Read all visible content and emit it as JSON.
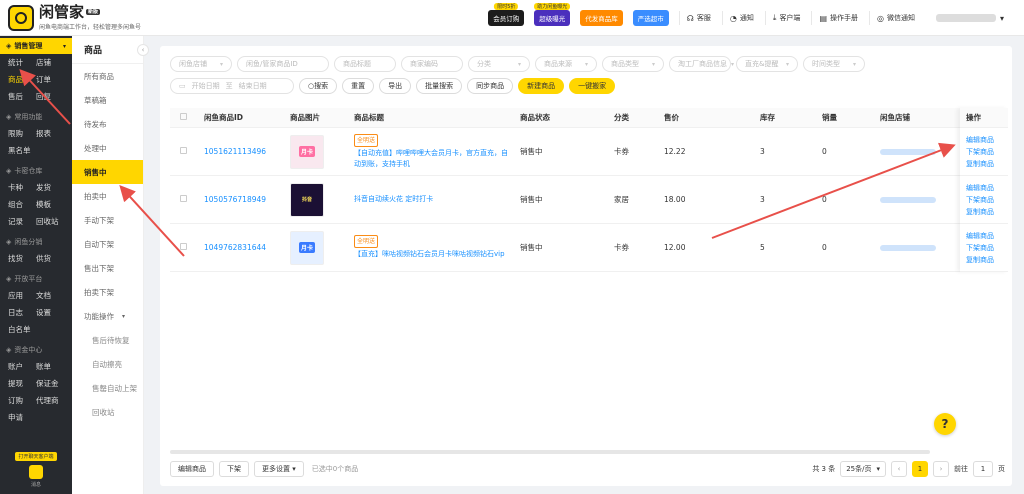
{
  "brand": {
    "name": "闲管家",
    "badge": "新版",
    "slogan": "闲鱼电商端工作台，轻松管理多闲鱼号"
  },
  "header": {
    "promos": [
      {
        "tag": "限时5折",
        "label": "会员订购",
        "bg": "#1c1c1c"
      },
      {
        "tag": "助力闲鱼曝光",
        "label": "超级曝光",
        "bg": "#4b2fbd"
      },
      {
        "tag": "",
        "label": "代发商品库",
        "bg": "#ff8a00"
      },
      {
        "tag": "",
        "label": "严选超市",
        "bg": "#3a8dff"
      }
    ],
    "links": [
      {
        "icon": "headset-icon",
        "glyph": "☊",
        "label": "客服"
      },
      {
        "icon": "bell-icon",
        "glyph": "◔",
        "label": "通知"
      },
      {
        "icon": "download-icon",
        "glyph": "⤓",
        "label": "客户端"
      },
      {
        "icon": "book-icon",
        "glyph": "▤",
        "label": "操作手册"
      },
      {
        "icon": "wechat-icon",
        "glyph": "◎",
        "label": "微信通知"
      }
    ]
  },
  "nav1": {
    "groups": [
      {
        "icon": "tag-icon",
        "title": "销售管理",
        "active": true,
        "items": [
          "统计",
          "店铺",
          "商品",
          "订单",
          "售后",
          "回复"
        ],
        "selected": "商品"
      },
      {
        "icon": "grid-icon",
        "title": "常用功能",
        "items": [
          "限购",
          "报表",
          "黑名单"
        ]
      },
      {
        "icon": "card-icon",
        "title": "卡密仓库",
        "items": [
          "卡种",
          "发货",
          "组合",
          "模板",
          "记录",
          "回收站"
        ]
      },
      {
        "icon": "share-icon",
        "title": "闲鱼分销",
        "items": [
          "找货",
          "供货"
        ]
      },
      {
        "icon": "api-icon",
        "title": "开放平台",
        "items": [
          "应用",
          "文档",
          "日志",
          "设置",
          "白名单"
        ]
      },
      {
        "icon": "wallet-icon",
        "title": "资金中心",
        "items": [
          "账户",
          "账单",
          "提现",
          "保证金",
          "订购",
          "代理商",
          "申请"
        ]
      }
    ],
    "bottom": {
      "tag": "打开聊天客户端",
      "label": "消息"
    }
  },
  "nav2": {
    "title": "商品",
    "items": [
      "所有商品",
      "草稿箱",
      "待发布",
      "处理中",
      "销售中",
      "拍卖中",
      "手动下架",
      "自动下架",
      "售出下架",
      "拍卖下架"
    ],
    "active": "销售中",
    "group": "功能操作",
    "subs": [
      "售后待恢复",
      "自动擦亮",
      "售罄自动上架",
      "回收站"
    ]
  },
  "filters": {
    "row1": [
      "闲鱼店铺",
      "闲鱼/管家商品ID",
      "商品标题",
      "商家编码",
      "分类",
      "商品来源",
      "商品类型",
      "淘工厂商品信息",
      "直充&提醒",
      "时间类型"
    ],
    "date_start": "开始日期",
    "date_sep": "至",
    "date_end": "结束日期",
    "buttons": [
      "搜索",
      "重置",
      "导出",
      "批量搜索",
      "同步商品"
    ],
    "yellow_buttons": [
      "新建商品",
      "一键搬家"
    ]
  },
  "table": {
    "headers": [
      "闲鱼商品ID",
      "商品图片",
      "商品标题",
      "商品状态",
      "分类",
      "售价",
      "库存",
      "销量",
      "闲鱼店铺",
      "操作"
    ],
    "rows": [
      {
        "id": "1051621113496",
        "badge": "全明送",
        "thumb_text": "月卡",
        "title": "【自动充值】哔哩哔哩大会员月卡，官方直充，自动到账，支持手机",
        "status": "销售中",
        "category": "卡券",
        "price": "12.22",
        "stock": "3",
        "sales": "0",
        "ops": [
          "编辑商品",
          "下架商品",
          "复制商品"
        ]
      },
      {
        "id": "1050576718949",
        "badge": "",
        "thumb_text": "抖音",
        "title": "抖音自动续火花 定时打卡",
        "status": "销售中",
        "category": "家居",
        "price": "18.00",
        "stock": "3",
        "sales": "0",
        "ops": [
          "编辑商品",
          "下架商品",
          "复制商品"
        ]
      },
      {
        "id": "1049762831644",
        "badge": "全明送",
        "thumb_text": "月卡",
        "title": "【直充】咪咕视频钻石会员月卡咪咕视频钻石vip",
        "status": "销售中",
        "category": "卡券",
        "price": "12.00",
        "stock": "5",
        "sales": "0",
        "ops": [
          "编辑商品",
          "下架商品",
          "复制商品"
        ]
      }
    ]
  },
  "pager": {
    "buttons": [
      "编辑商品",
      "下架",
      "更多设置"
    ],
    "selected_hint": "已选中0个商品",
    "total": "共 3 条",
    "size": "25条/页",
    "current": "1",
    "goto": "前往",
    "goto_value": "1",
    "page_unit": "页"
  },
  "help": "?",
  "colors": {
    "accent": "#ffd600",
    "link": "#1890ff",
    "sidebar": "#272a2f",
    "arrow": "#e8504a"
  }
}
